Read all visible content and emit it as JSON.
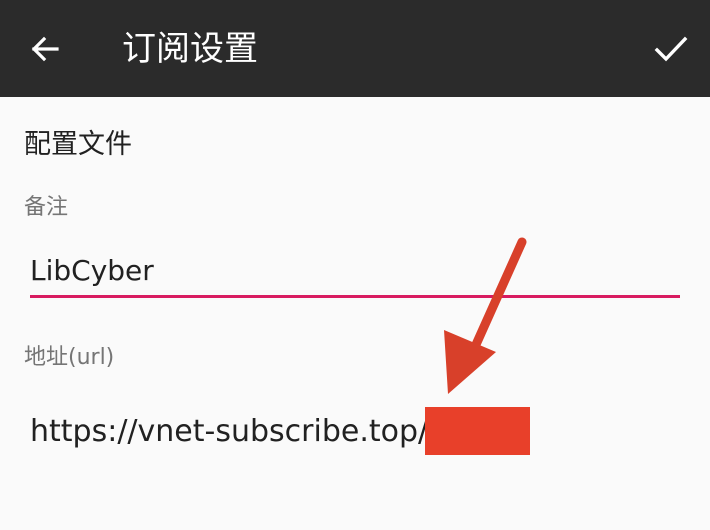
{
  "app_bar": {
    "title": "订阅设置",
    "back_icon": "arrow-left-icon",
    "confirm_icon": "check-icon",
    "background_color": "#2b2b2b"
  },
  "form": {
    "section_header": "配置文件",
    "remark": {
      "label": "备注",
      "value": "LibCyber"
    },
    "url": {
      "label": "地址(url)",
      "value": "https://vnet-subscribe.top/s/"
    },
    "accent_color": "#d81b60"
  },
  "annotation": {
    "arrow_color": "#d8402a",
    "redaction_color": "#e8402a"
  }
}
